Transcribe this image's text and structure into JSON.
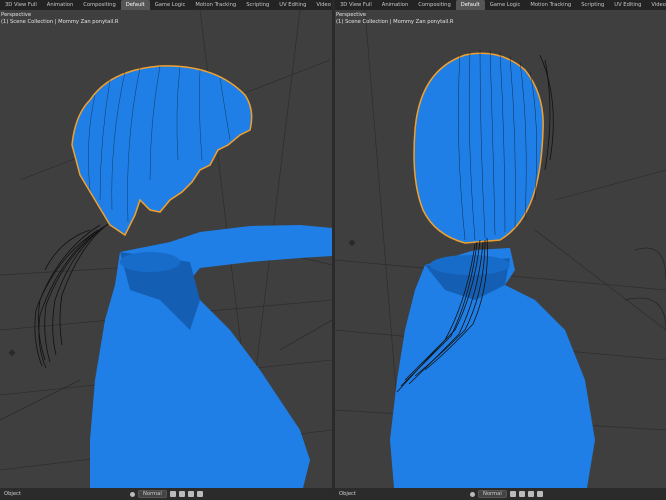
{
  "left": {
    "tabs": [
      "3D View Full",
      "Animation",
      "Compositing",
      "Default",
      "Game Logic",
      "Motion Tracking",
      "Scripting",
      "UV Editing",
      "Video Editing"
    ],
    "active_tab": "Default",
    "view_label": "Perspective",
    "collection_label": "(1) Scene Collection | Mommy Zan ponytail.R",
    "mode": "Object",
    "shading": "Normal"
  },
  "right": {
    "tabs": [
      "3D View Full",
      "Animation",
      "Compositing",
      "Default",
      "Game Logic",
      "Motion Tracking",
      "Scripting",
      "UV Editing",
      "Video Editing"
    ],
    "active_tab": "Default",
    "view_label": "Perspective",
    "collection_label": "(1) Scene Collection | Mommy Zan ponytail.R",
    "mode": "Object",
    "shading": "Normal"
  },
  "colors": {
    "mesh": "#1f7fe6",
    "mesh_dark": "#145fb3",
    "selection": "#f0a030",
    "hair": "#111111",
    "viewport": "#3f3f3f"
  }
}
